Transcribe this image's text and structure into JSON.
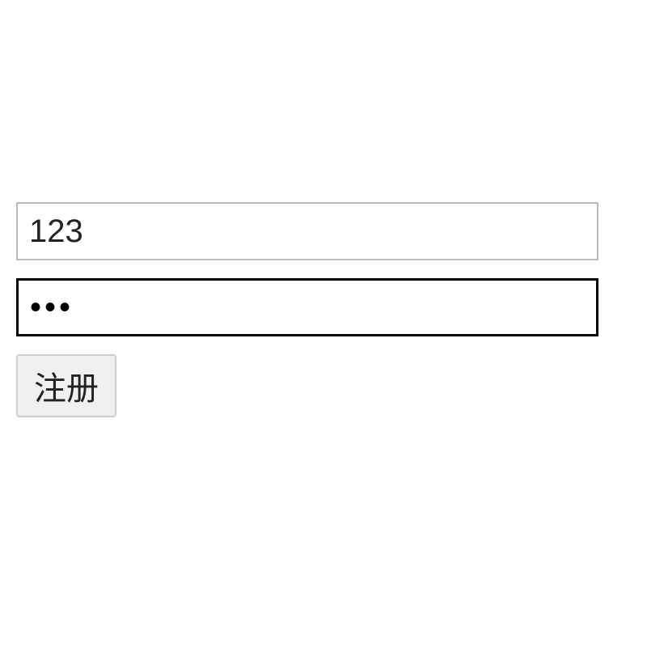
{
  "form": {
    "username_value": "123",
    "password_value": "123",
    "submit_label": "注册"
  }
}
